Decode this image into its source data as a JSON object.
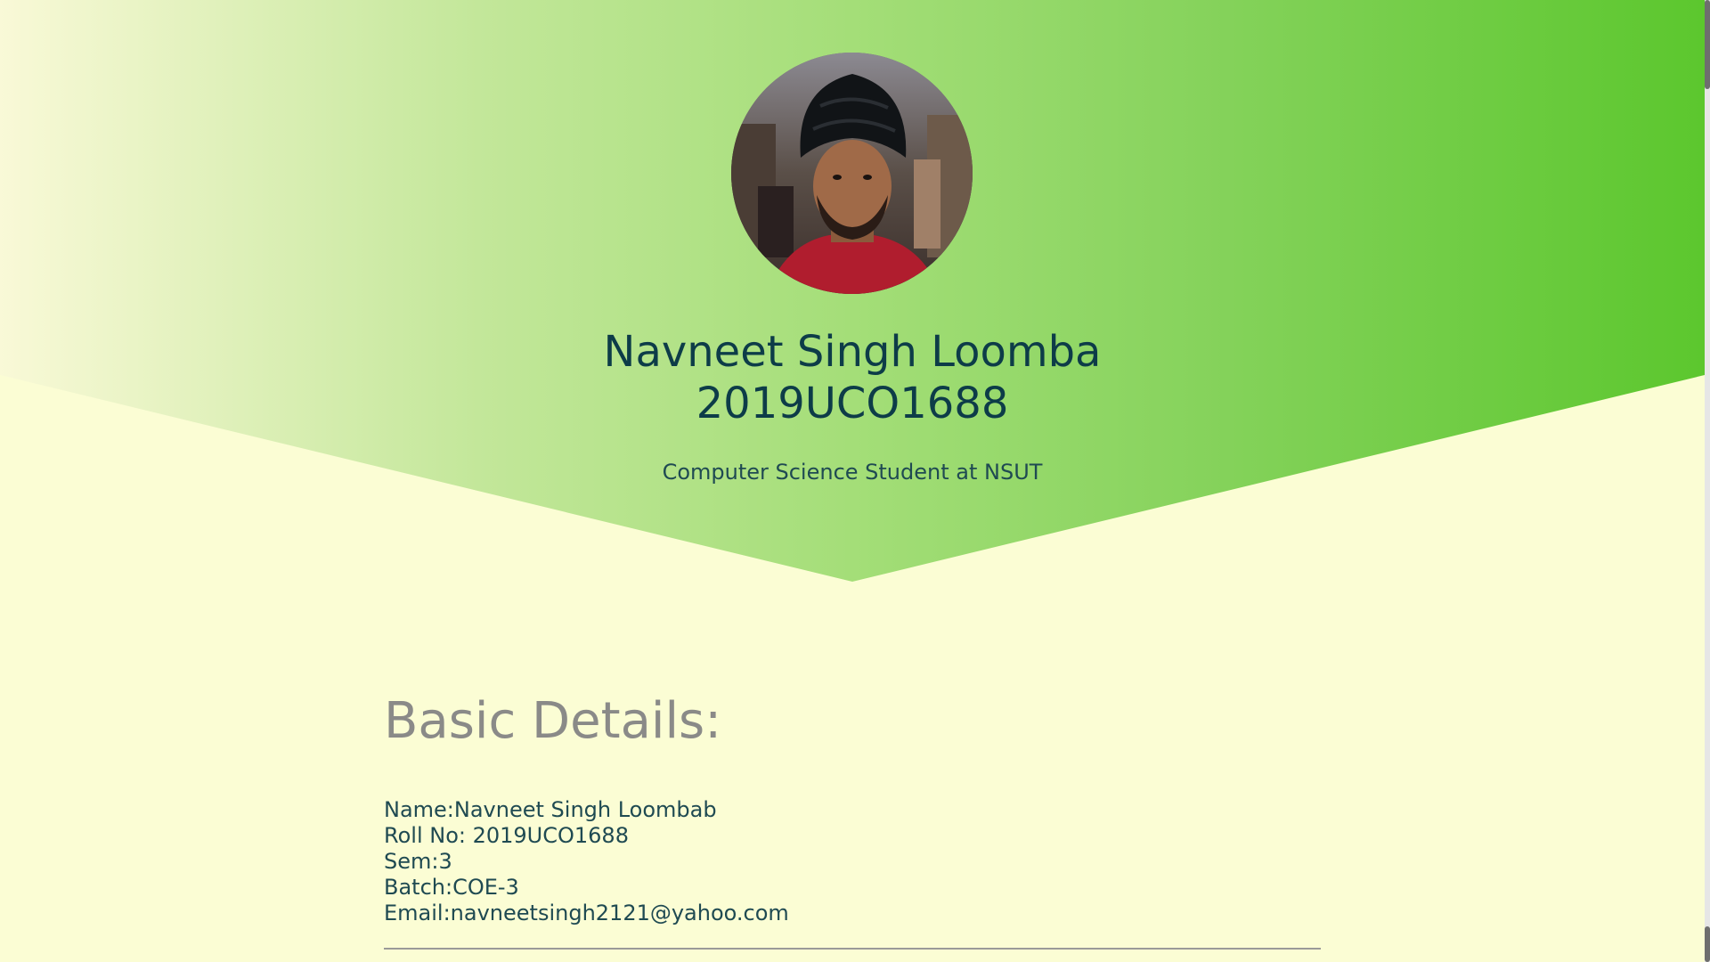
{
  "hero": {
    "name": "Navneet Singh Loomba",
    "roll": "2019UCO1688",
    "tagline": "Computer Science Student at NSUT",
    "avatar_alt": "profile-photo"
  },
  "basic_details": {
    "heading": "Basic Details:",
    "name_line": "Name:Navneet Singh Loombab",
    "roll_line": "Roll No: 2019UCO1688",
    "sem_line": "Sem:3",
    "batch_line": "Batch:COE-3",
    "email_line": "Email:navneetsingh2121@yahoo.com"
  },
  "colors": {
    "background": "#fbfdd4",
    "gradient_start": "#f9f9d7",
    "gradient_end": "#5cc72e",
    "heading_text": "#0d3c48",
    "section_heading": "#8a8a88"
  }
}
